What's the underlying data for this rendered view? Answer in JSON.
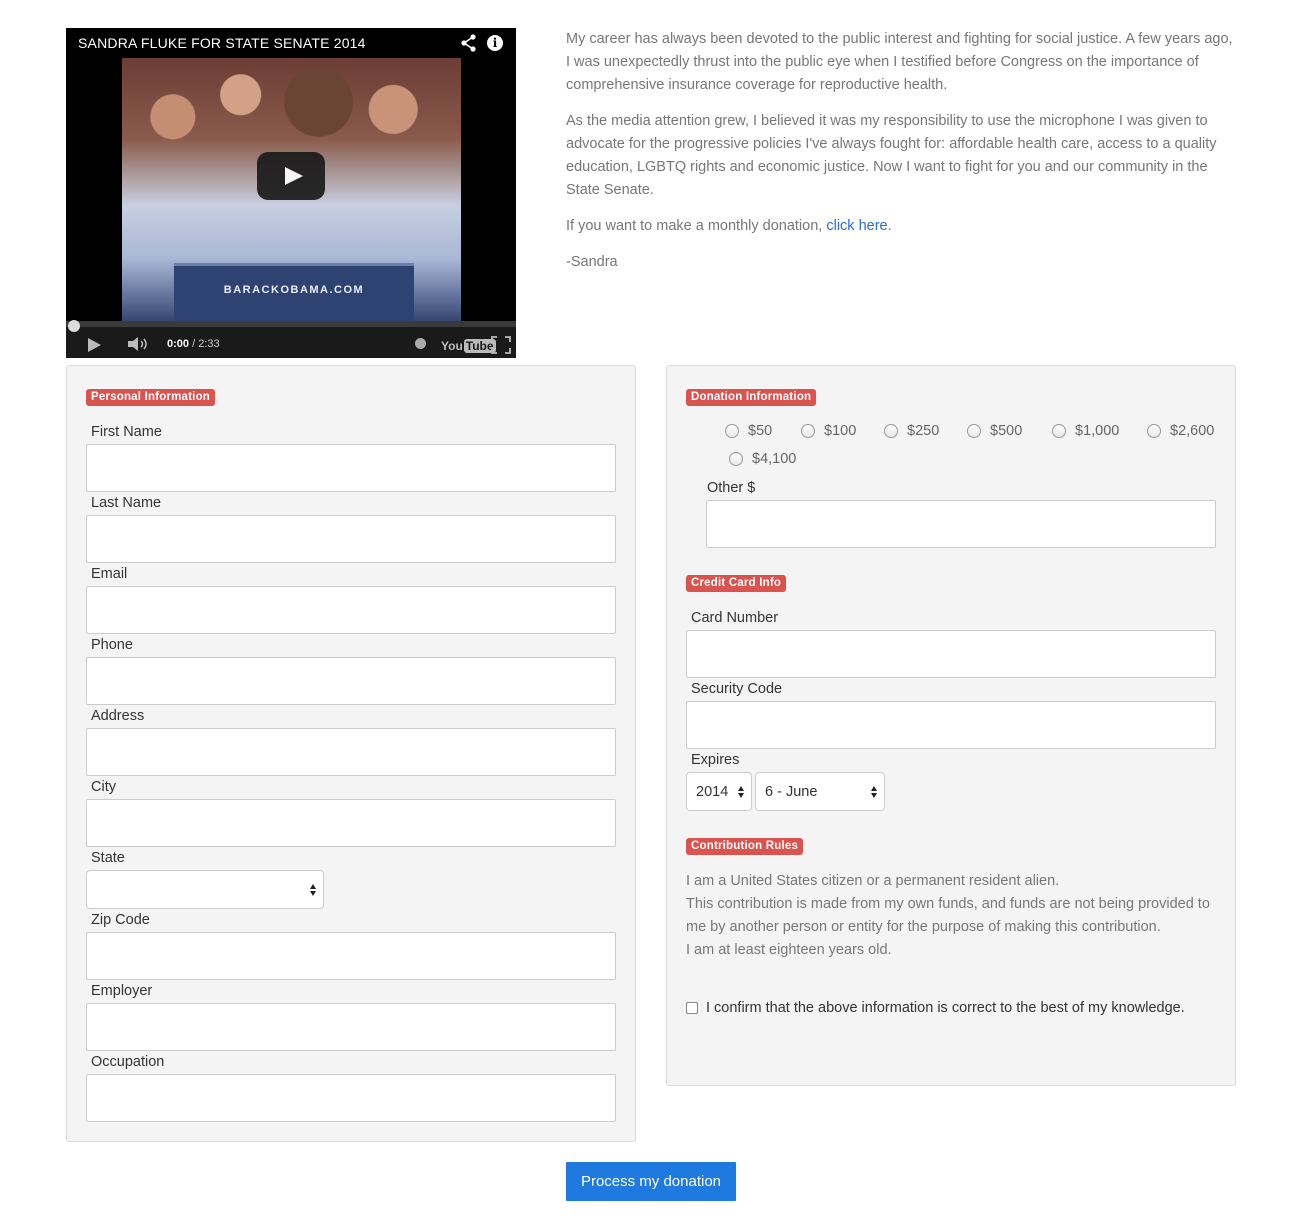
{
  "video": {
    "title": "SANDRA FLUKE FOR STATE SENATE 2014",
    "podium_text": "BARACKOBAMA.COM",
    "time_current": "0:00",
    "time_total": " / 2:33",
    "youtube_label": "You",
    "youtube_label_tube": "Tube",
    "progress": 0
  },
  "intro": {
    "p1": "My career has always been devoted to the public interest and fighting for social justice. A few years ago, I was unexpectedly thrust into the public eye when I testified before Congress on the importance of comprehensive insurance coverage for reproductive health.",
    "p2": "As the media attention grew, I believed it was my responsibility to use the microphone I was given to advocate for the progressive policies I've always fought for: affordable health care, access to a quality education, LGBTQ rights and economic justice. Now I want to fight for you and our community in the State Senate.",
    "p3_prefix": "If you want to make a monthly donation, ",
    "p3_link": "click here",
    "p3_suffix": ".",
    "signature": "-Sandra"
  },
  "personal": {
    "badge": "Personal Information",
    "first_name": "First Name",
    "last_name": "Last Name",
    "email": "Email",
    "phone": "Phone",
    "address": "Address",
    "city": "City",
    "state": "State",
    "state_value": "",
    "zip": "Zip Code",
    "employer": "Employer",
    "occupation": "Occupation"
  },
  "donation": {
    "badge": "Donation Information",
    "amounts": [
      "$50",
      "$100",
      "$250",
      "$500",
      "$1,000",
      "$2,600",
      "$4,100"
    ],
    "other_label": "Other $"
  },
  "card": {
    "badge": "Credit Card Info",
    "number_label": "Card Number",
    "security_label": "Security Code",
    "expires_label": "Expires",
    "expires_year": "2014",
    "expires_month": "6 - June"
  },
  "rules": {
    "badge": "Contribution Rules",
    "line1": "I am a United States citizen or a permanent resident alien.",
    "line2": "This contribution is made from my own funds, and funds are not being provided to me by another person or entity for the purpose of making this contribution.",
    "line3": "I am at least eighteen years old.",
    "confirm": "I confirm that the above information is correct to the best of my knowledge."
  },
  "submit_label": "Process my donation"
}
